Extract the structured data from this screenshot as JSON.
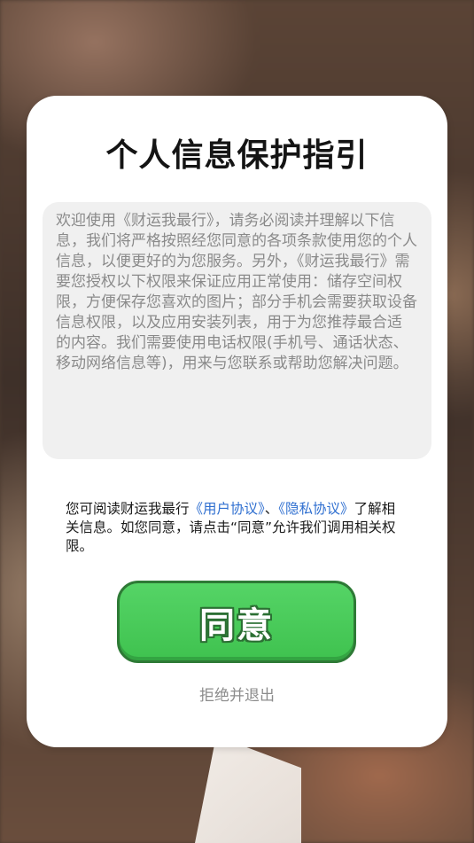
{
  "dialog": {
    "title": "个人信息保护指引",
    "content": "欢迎使用《财运我最行》，请务必阅读并理解以下信息，我们将严格按照经您同意的各项条款使用您的个人信息，以便更好的为您服务。另外，《财运我最行》需要您授权以下权限来保证应用正常使用：储存空间权限，方便保存您喜欢的图片；部分手机会需要获取设备信息权限，以及应用安装列表，用于为您推荐最合适 的内容。我们需要使用电话权限(手机号、通话状态、移动网络信息等)，用来与您联系或帮助您解决问题。",
    "notice": {
      "prefix": "您可阅读财运我最行",
      "user_agreement": "《用户协议》",
      "separator": "、",
      "privacy_agreement": "《隐私协议》",
      "suffix": "了解相关信息。如您同意，请点击“同意”允许我们调用相关权限。"
    },
    "agree_label": "同意",
    "refuse_label": "拒绝并退出"
  },
  "colors": {
    "link": "#2f6fd0",
    "agree_button": "#45c653",
    "agree_border": "#2e7a36"
  }
}
